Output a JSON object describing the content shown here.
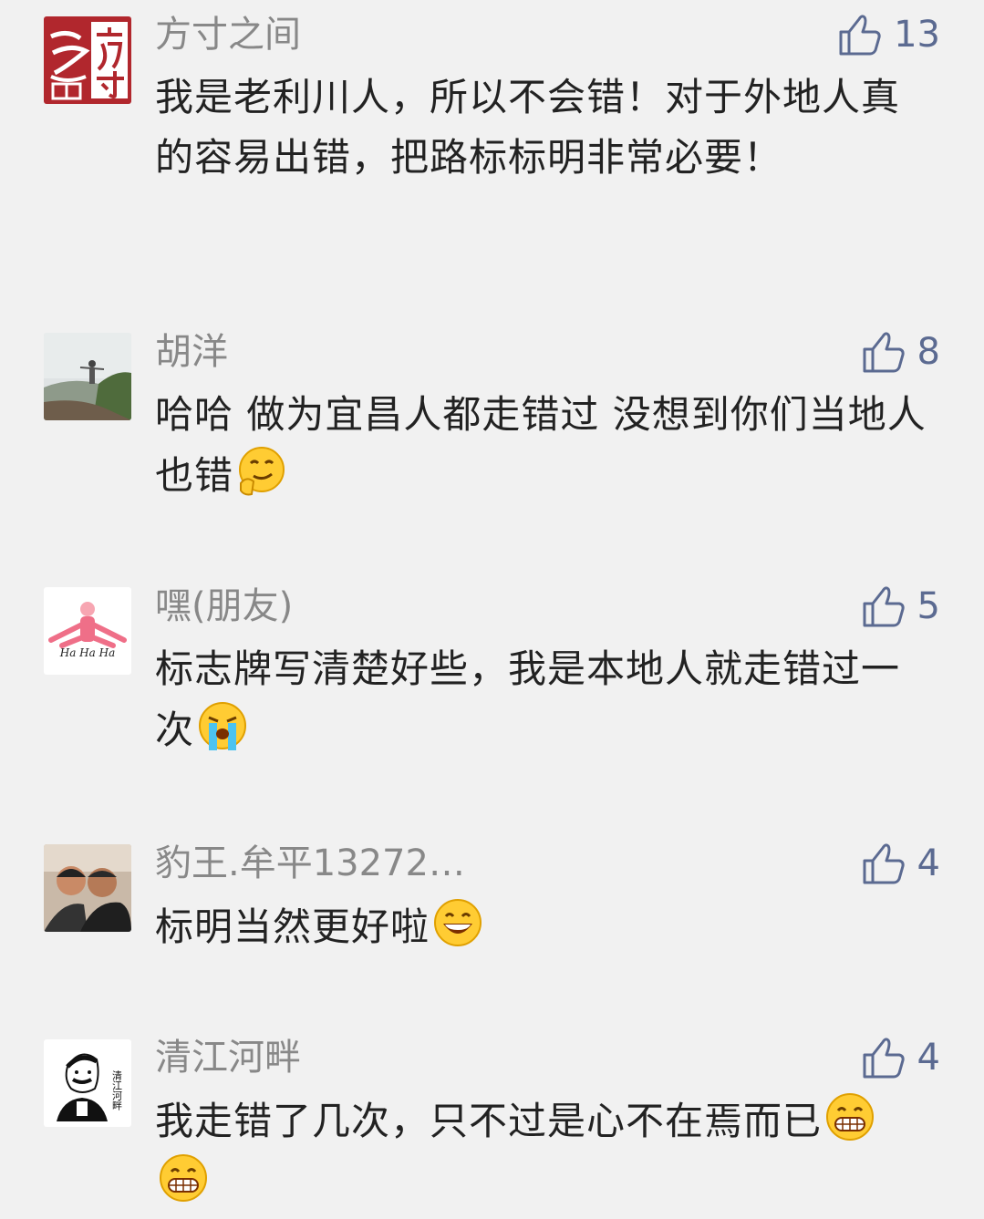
{
  "comments": [
    {
      "author": "方寸之间",
      "likes": "13",
      "text": "我是老利川人，所以不会错！对于外地人真的容易出错，把路标标明非常必要！",
      "avatar": "calligraphy-logo"
    },
    {
      "author": "胡洋",
      "likes": "8",
      "text": "哈哈 做为宜昌人都走错过 没想到你们当地人也错",
      "emoji": [
        "thinking-face"
      ],
      "avatar": "mountain-photo"
    },
    {
      "author": "嘿(朋友)",
      "likes": "5",
      "text": "标志牌写清楚好些，我是本地人就走错过一次",
      "emoji": [
        "crying-face"
      ],
      "avatar": "hahaha-cartoon",
      "avatar_text": "Ha Ha Ha"
    },
    {
      "author": "豹王.牟平13272…",
      "likes": "4",
      "text": "标明当然更好啦",
      "emoji": [
        "grinning-face"
      ],
      "avatar": "couple-photo"
    },
    {
      "author": "清江河畔",
      "likes": "4",
      "text": "我走错了几次，只不过是心不在焉而已",
      "emoji": [
        "grimacing-face",
        "grimacing-face"
      ],
      "avatar": "sketch-portrait",
      "avatar_text": "清江河畔"
    }
  ],
  "colors": {
    "background": "#f1f1f1",
    "name": "#888888",
    "body": "#222222",
    "like": "#5b6a91"
  }
}
